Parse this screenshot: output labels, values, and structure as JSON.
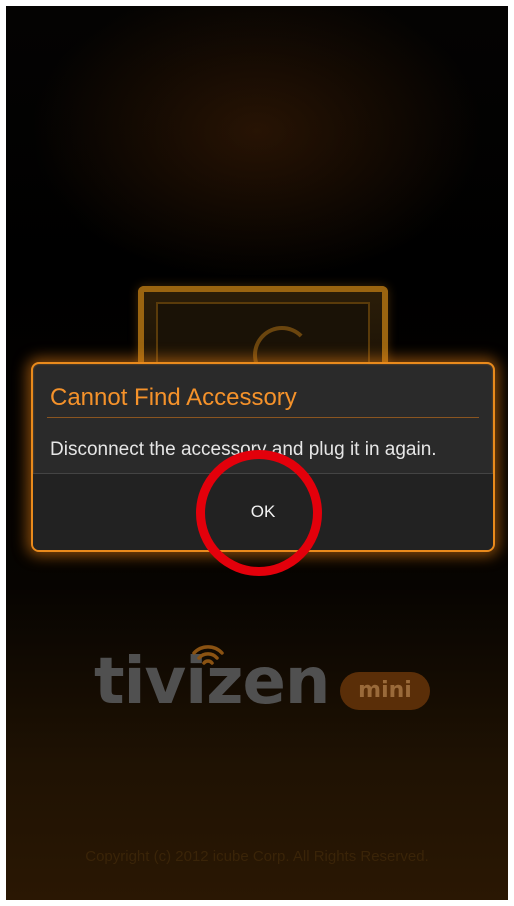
{
  "dialog": {
    "title": "Cannot Find Accessory",
    "message": "Disconnect the accessory and plug it in again.",
    "ok_label": "OK"
  },
  "logo": {
    "wordmark": "tivizen",
    "badge": "mini",
    "signal_icon": "wifi-signal-icon"
  },
  "footer": {
    "copyright": "Copyright (c) 2012 icube Corp. All Rights Reserved."
  },
  "colors": {
    "accent": "#e98a1c",
    "title": "#f5922a",
    "annotation": "#e3000b"
  }
}
